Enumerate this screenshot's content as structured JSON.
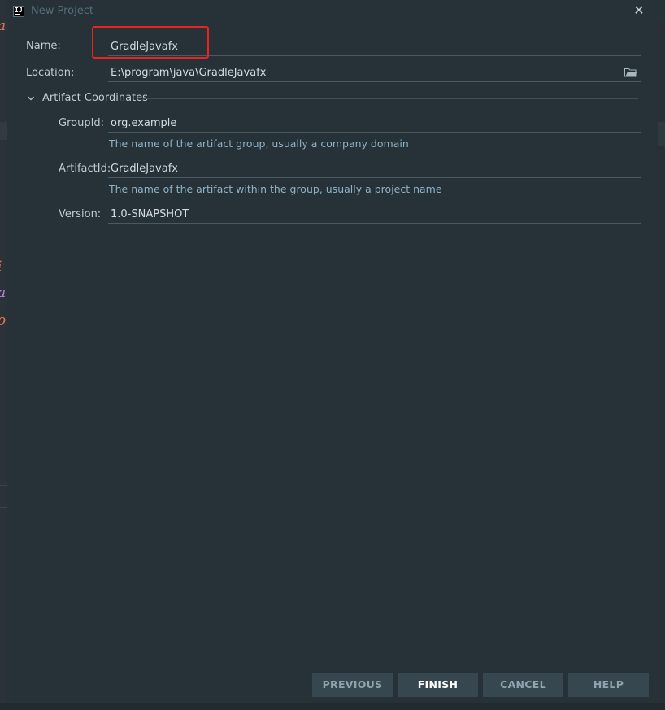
{
  "window": {
    "title": "New Project",
    "app_icon_text": "IJ",
    "close_glyph": "✕"
  },
  "form": {
    "name": {
      "label": "Name:",
      "value": "GradleJavafx"
    },
    "location": {
      "label": "Location:",
      "value": "E:\\program\\java\\GradleJavafx"
    },
    "artifact_section": {
      "label": "Artifact Coordinates",
      "expanded": true,
      "group_id": {
        "label": "GroupId:",
        "value": "org.example",
        "hint": "The name of the artifact group, usually a company domain"
      },
      "artifact_id": {
        "label": "ArtifactId:",
        "value": "GradleJavafx",
        "hint": "The name of the artifact within the group, usually a project name"
      },
      "version": {
        "label": "Version:",
        "value": "1.0-SNAPSHOT"
      }
    }
  },
  "buttons": {
    "previous": "PREVIOUS",
    "finish": "FINISH",
    "cancel": "CANCEL",
    "help": "HELP"
  },
  "icons": {
    "app": "intellij-idea-icon",
    "close": "close-icon",
    "browse": "folder-icon",
    "toggle": "chevron-down-icon"
  },
  "colors": {
    "background": "#263238",
    "button": "#37474F",
    "hint_text": "#8FB2C5",
    "highlight": "#E5251E"
  }
}
